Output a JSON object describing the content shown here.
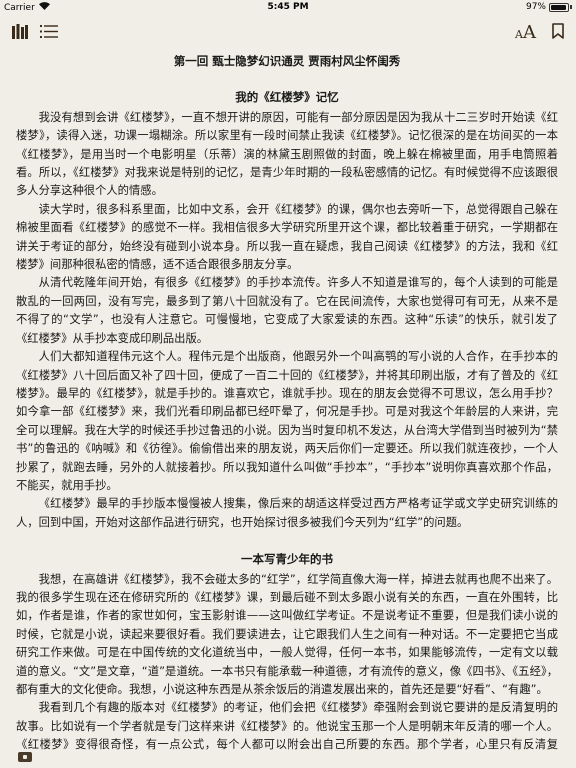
{
  "status_bar": {
    "carrier": "Carrier",
    "time": "5:45 PM",
    "battery_percent_label": "97%",
    "battery_level": 0.97
  },
  "toolbar": {
    "library_icon": "library-icon",
    "toc_icon": "list-icon",
    "font_small": "A",
    "font_large": "A",
    "bookmark_icon": "bookmark-icon",
    "accent_color": "#3a2a1a"
  },
  "chapter": {
    "title": "第一回 甄士隐梦幻识通灵 贾雨村风尘怀闺秀"
  },
  "sections": [
    {
      "title": "我的《红楼梦》记忆",
      "paragraphs": [
        "我没有想到会讲《红楼梦》，一直不想开讲的原因，可能有一部分原因是因为我从十二三岁时开始读《红楼梦》，读得入迷，功课一塌糊涂。所以家里有一段时间禁止我读《红楼梦》。记忆很深的是在坊间买的一本《红楼梦》，是用当时一个电影明星（乐蒂）演的林黛玉剧照做的封面，晚上躲在棉被里面，用手电筒照着看。所以，《红楼梦》对我来说是特别的记忆，是青少年时期的一段私密感情的记忆。有时候觉得不应该跟很多人分享这种很个人的情感。",
        "读大学时，很多科系里面，比如中文系，会开《红楼梦》的课，偶尔也去旁听一下，总觉得跟自己躲在棉被里面看《红楼梦》的感觉不一样。我相信很多大学研究所里开这个课，都比较着重于研究，一学期都在讲关于考证的部分，始终没有碰到小说本身。所以我一直在疑虑，我自己阅读《红楼梦》的方法，我和《红楼梦》间那种很私密的情感，适不适合跟很多朋友分享。",
        "从清代乾隆年间开始，有很多《红楼梦》的手抄本流传。许多人不知道是谁写的，每个人读到的可能是散乱的一回两回，没有写完，最多到了第八十回就没有了。它在民间流传，大家也觉得可有可无，从来不是不得了的“文学”，也没有人注意它。可慢慢地，它变成了大家爱读的东西。这种“乐读”的快乐，就引发了《红楼梦》从手抄本变成印刷品出版。",
        "人们大都知道程伟元这个人。程伟元是个出版商，他跟另外一个叫高鹗的写小说的人合作，在手抄本的《红楼梦》八十回后面又补了四十回，便成了一百二十回的《红楼梦》，并将其印刷出版，才有了普及的《红楼梦》。最早的《红楼梦》，就是手抄的。谁喜欢它，谁就手抄。现在的朋友会觉得不可思议，怎么用手抄？如今拿一部《红楼梦》来，我们光看印刷品都已经吓晕了，何况是手抄。可是对我这个年龄层的人来讲，完全可以理解。我在大学的时候还手抄过鲁迅的小说。因为当时复印机不发达，从台湾大学借到当时被列为“禁书”的鲁迅的《呐喊》和《彷徨》。偷偷借出来的朋友说，两天后你们一定要还。所以我们就连夜抄，一个人抄累了，就跑去睡，另外的人就接着抄。所以我知道什么叫做“手抄本”，“手抄本”说明你真喜欢那个作品，不能买，就用手抄。",
        "《红楼梦》最早的手抄版本慢慢被人搜集，像后来的胡适这样受过西方严格考证学或文学史研究训练的人，回到中国，开始对这部作品进行研究，也开始探讨很多被我们今天列为“红学”的问题。"
      ]
    },
    {
      "title": "一本写青少年的书",
      "paragraphs": [
        "我想，在高雄讲《红楼梦》，我不会碰太多的“红学”，红学简直像大海一样，掉进去就再也爬不出来了。我的很多学生现在还在修研究所的《红楼梦》课，到最后碰不到太多跟小说有关的东西，一直在外围转，比如，作者是谁，作者的家世如何，宝玉影射谁——这叫做红学考证。不是说考证不重要，但是我们读小说的时候，它就是小说，读起来要很好看。我们要读进去，让它跟我们人生之间有一种对话。不一定要把它当成研究工作来做。可是在中国传统的文化道统当中，一般人觉得，任何一本书，如果能够流传，一定有文以载道的意义。“文”是文章，“道”是道统。一本书只有能承载一种道德，才有流传的意义，像《四书》、《五经》，都有重大的文化使命。我想，小说这种东西是从茶余饭后的消遣发展出来的，首先还是要“好看”、“有趣”。",
        "我看到几个有趣的版本对《红楼梦》的考证，他们会把《红楼梦》牵强附会到说它要讲的是反清复明的故事。比如说有一个学者就是专门这样来讲《红楼梦》的。他说宝玉那一个人是明朝末年反清的哪一个人。《红楼梦》变得很奇怪，有一点公式，每个人都可以附会出自己所要的东西。那个学者，心里只有反清复明，就在这里面牵强反清复明。"
      ]
    }
  ]
}
